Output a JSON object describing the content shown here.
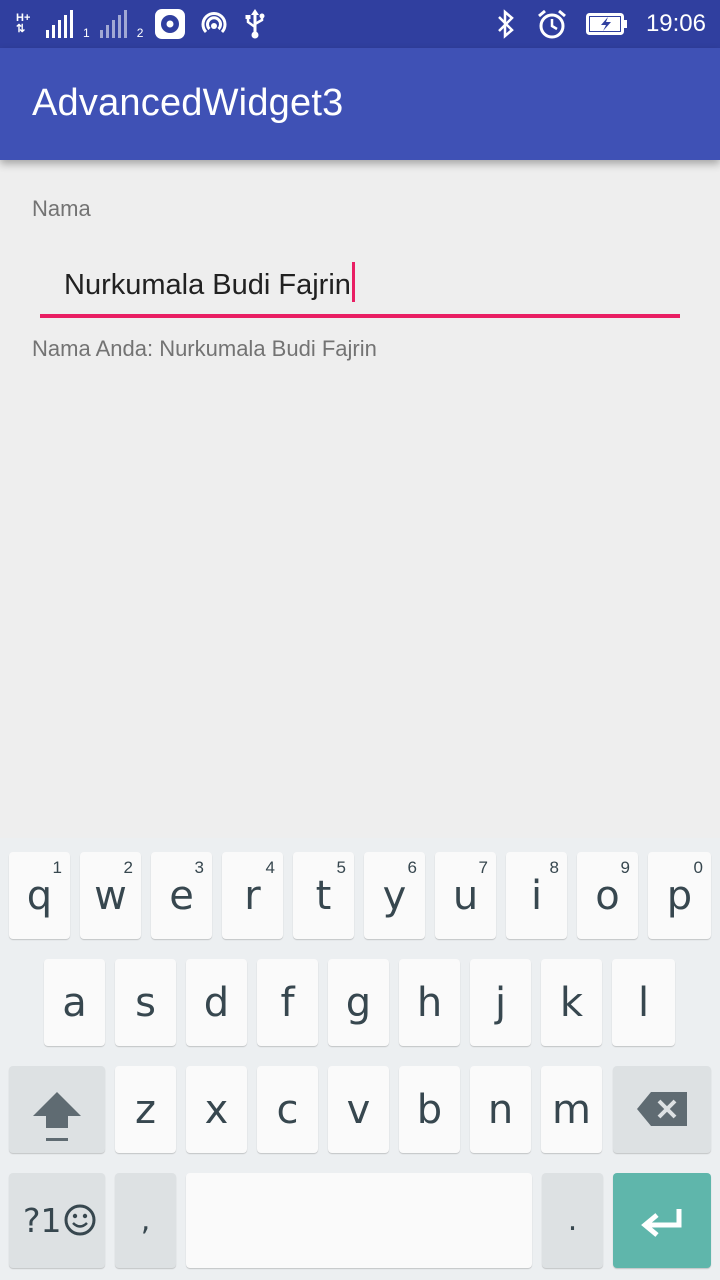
{
  "status_bar": {
    "network_label": "H+",
    "sim1": "1",
    "sim2": "2",
    "time": "19:06"
  },
  "app_bar": {
    "title": "AdvancedWidget3"
  },
  "form": {
    "name_label": "Nama",
    "name_value": "Nurkumala Budi Fajrin",
    "result_text": "Nama Anda: Nurkumala Budi Fajrin"
  },
  "keyboard": {
    "row1": [
      {
        "ch": "q",
        "hint": "1"
      },
      {
        "ch": "w",
        "hint": "2"
      },
      {
        "ch": "e",
        "hint": "3"
      },
      {
        "ch": "r",
        "hint": "4"
      },
      {
        "ch": "t",
        "hint": "5"
      },
      {
        "ch": "y",
        "hint": "6"
      },
      {
        "ch": "u",
        "hint": "7"
      },
      {
        "ch": "i",
        "hint": "8"
      },
      {
        "ch": "o",
        "hint": "9"
      },
      {
        "ch": "p",
        "hint": "0"
      }
    ],
    "row2": [
      "a",
      "s",
      "d",
      "f",
      "g",
      "h",
      "j",
      "k",
      "l"
    ],
    "row3": [
      "z",
      "x",
      "c",
      "v",
      "b",
      "n",
      "m"
    ],
    "symbols_label": "?1",
    "comma": ",",
    "period": ".",
    "shift_icon": "shift-arrow-icon",
    "backspace_icon": "backspace-icon",
    "enter_icon": "enter-arrow-icon",
    "emoji_icon": "emoji-icon"
  },
  "colors": {
    "status_bar": "#303f9f",
    "app_bar": "#3f51b5",
    "accent": "#e91e63",
    "enter_key": "#5fb6ab"
  }
}
